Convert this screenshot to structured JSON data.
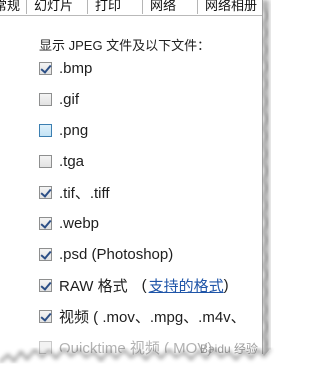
{
  "tabs": [
    "常规",
    "幻灯片",
    "打印",
    "网络",
    "网络相册"
  ],
  "heading": "显示 JPEG 文件及以下文件：",
  "formats": [
    {
      "label": ".bmp",
      "checked": true
    },
    {
      "label": ".gif",
      "checked": false
    },
    {
      "label": ".png",
      "checked": false
    },
    {
      "label": ".tga",
      "checked": false
    },
    {
      "label": ".tif、.tiff",
      "checked": true
    },
    {
      "label": ".webp",
      "checked": true
    },
    {
      "label": ".psd (Photoshop)",
      "checked": true
    },
    {
      "label": "RAW 格式",
      "checked": true
    },
    {
      "label": "视频 ( .mov、.mpg、.m4v、",
      "checked": true
    },
    {
      "label": "Quicktime 视频 ( MOV)",
      "checked": false
    }
  ],
  "raw_link": {
    "open": "(",
    "link": "支持的格式",
    "close": ")"
  },
  "watermark": "Baidu 经验"
}
